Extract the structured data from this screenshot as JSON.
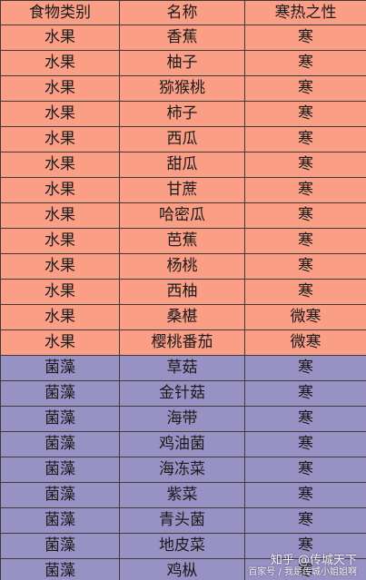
{
  "colors": {
    "fruit_row": "#fb9e86",
    "fungi_row": "#9892c4",
    "header_row": "#fb9e86",
    "border": "#3a3a3a"
  },
  "table": {
    "headers": [
      "食物类别",
      "名称",
      "寒热之性"
    ],
    "rows": [
      {
        "category": "水果",
        "name": "香蕉",
        "nature": "寒",
        "group": "fruit"
      },
      {
        "category": "水果",
        "name": "柚子",
        "nature": "寒",
        "group": "fruit"
      },
      {
        "category": "水果",
        "name": "猕猴桃",
        "nature": "寒",
        "group": "fruit"
      },
      {
        "category": "水果",
        "name": "柿子",
        "nature": "寒",
        "group": "fruit"
      },
      {
        "category": "水果",
        "name": "西瓜",
        "nature": "寒",
        "group": "fruit"
      },
      {
        "category": "水果",
        "name": "甜瓜",
        "nature": "寒",
        "group": "fruit"
      },
      {
        "category": "水果",
        "name": "甘蔗",
        "nature": "寒",
        "group": "fruit"
      },
      {
        "category": "水果",
        "name": "哈密瓜",
        "nature": "寒",
        "group": "fruit"
      },
      {
        "category": "水果",
        "name": "芭蕉",
        "nature": "寒",
        "group": "fruit"
      },
      {
        "category": "水果",
        "name": "杨桃",
        "nature": "寒",
        "group": "fruit"
      },
      {
        "category": "水果",
        "name": "西柚",
        "nature": "寒",
        "group": "fruit"
      },
      {
        "category": "水果",
        "name": "桑椹",
        "nature": "微寒",
        "group": "fruit"
      },
      {
        "category": "水果",
        "name": "樱桃番茄",
        "nature": "微寒",
        "group": "fruit"
      },
      {
        "category": "菌藻",
        "name": "草菇",
        "nature": "寒",
        "group": "fungi"
      },
      {
        "category": "菌藻",
        "name": "金针菇",
        "nature": "寒",
        "group": "fungi"
      },
      {
        "category": "菌藻",
        "name": "海带",
        "nature": "寒",
        "group": "fungi"
      },
      {
        "category": "菌藻",
        "name": "鸡油菌",
        "nature": "寒",
        "group": "fungi"
      },
      {
        "category": "菌藻",
        "name": "海冻菜",
        "nature": "寒",
        "group": "fungi"
      },
      {
        "category": "菌藻",
        "name": "紫菜",
        "nature": "寒",
        "group": "fungi"
      },
      {
        "category": "菌藻",
        "name": "青头菌",
        "nature": "寒",
        "group": "fungi"
      },
      {
        "category": "菌藻",
        "name": "地皮菜",
        "nature": "寒",
        "group": "fungi"
      },
      {
        "category": "菌藻",
        "name": "鸡枞",
        "nature": "寒",
        "group": "fungi"
      }
    ]
  },
  "watermark": {
    "line1": "知乎 @传城天下",
    "line2": "百家号 / 我是传城小姐姐啊"
  }
}
